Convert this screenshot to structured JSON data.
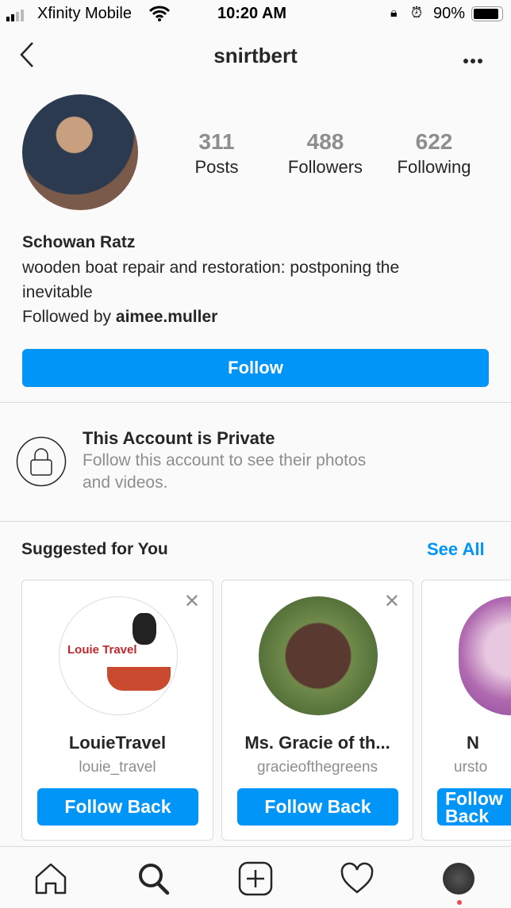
{
  "status_bar": {
    "carrier": "Xfinity Mobile",
    "time": "10:20 AM",
    "battery": "90%"
  },
  "header": {
    "username": "snirtbert",
    "back_icon": "chevron-left-icon",
    "more_icon": "ellipsis-icon"
  },
  "profile": {
    "stats": [
      {
        "value": "311",
        "label": "Posts"
      },
      {
        "value": "488",
        "label": "Followers"
      },
      {
        "value": "622",
        "label": "Following"
      }
    ],
    "name": "Schowan Ratz",
    "bio_line1": "wooden boat repair and restoration: postponing the",
    "bio_line2": "inevitable",
    "followed_by_prefix": "Followed by ",
    "followed_by_user": "aimee.muller",
    "follow_label": "Follow"
  },
  "private": {
    "title": "This Account is Private",
    "line1": "Follow this account to see their photos",
    "line2": "and videos."
  },
  "suggested": {
    "title": "Suggested for You",
    "see_all": "See All",
    "cards": [
      {
        "name": "LouieTravel",
        "handle": "louie_travel",
        "button": "Follow Back",
        "logo_text": "Louie Travel"
      },
      {
        "name": "Ms. Gracie of th...",
        "handle": "gracieofthegreens",
        "button": "Follow Back"
      },
      {
        "name": "N",
        "handle": "ursto",
        "button": "Follow Back"
      }
    ]
  },
  "colors": {
    "accent": "#0095f6"
  }
}
